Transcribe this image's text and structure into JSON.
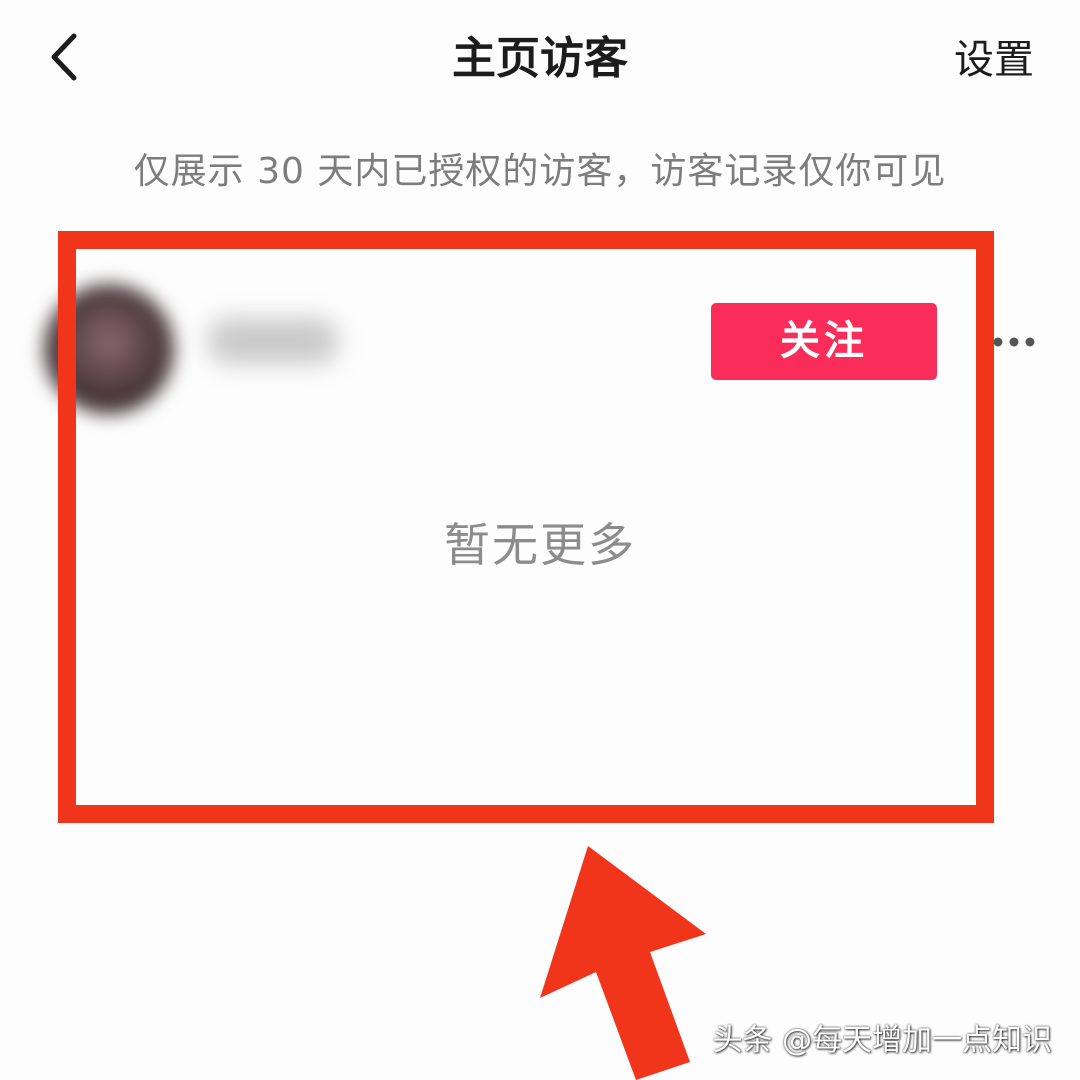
{
  "header": {
    "back_icon": "chevron-left-icon",
    "title": "主页访客",
    "settings_label": "设置"
  },
  "notice": "仅展示 30 天内已授权的访客，访客记录仅你可见",
  "visitor": {
    "avatar": "blurred-avatar",
    "follow_label": "关注",
    "more_icon": "more-horizontal-icon"
  },
  "empty_state": "暂无更多",
  "watermark": "头条 @每天增加一点知识",
  "colors": {
    "follow_button": "#fa2d5a",
    "annotation_red": "#f1351a",
    "title_text": "#1c1c1c",
    "secondary_text": "#7d7d7d"
  }
}
